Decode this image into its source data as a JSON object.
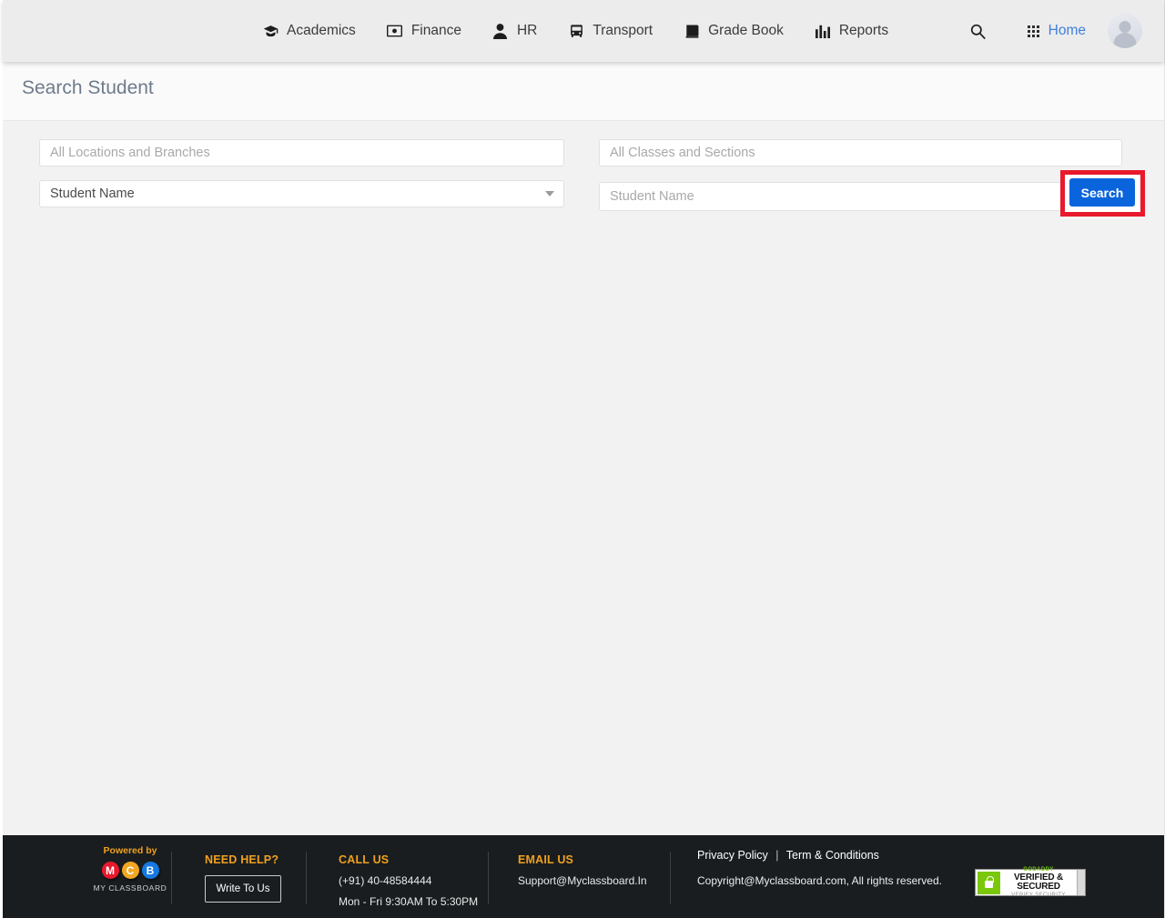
{
  "nav": {
    "items": [
      {
        "label": "Academics",
        "icon": "graduation-cap-icon"
      },
      {
        "label": "Finance",
        "icon": "banknote-icon"
      },
      {
        "label": "HR",
        "icon": "person-icon"
      },
      {
        "label": "Transport",
        "icon": "bus-icon"
      },
      {
        "label": "Grade Book",
        "icon": "book-icon"
      },
      {
        "label": "Reports",
        "icon": "bar-chart-icon"
      }
    ],
    "search_icon": "search-icon",
    "apps_icon": "apps-grid-icon",
    "home_label": "Home",
    "home_color": "#3f7fdb",
    "avatar_icon": "user-avatar-icon"
  },
  "header": {
    "title": "Search Student"
  },
  "form": {
    "locations_placeholder": "All Locations and Branches",
    "locations_value": "",
    "classes_placeholder": "All Classes and Sections",
    "classes_value": "",
    "search_by_value": "Student Name",
    "search_by_caret": "chevron-down-icon",
    "student_name_placeholder": "Student Name",
    "student_name_value": "",
    "search_button_label": "Search",
    "search_button_color": "#0a65dd",
    "highlight_color": "#e8192c"
  },
  "footer": {
    "powered_by_label": "Powered by",
    "brand_letters": [
      "M",
      "C",
      "B"
    ],
    "brand_name": "MY CLASSBOARD",
    "brand_colors": [
      "#e8192c",
      "#f2a621",
      "#1579e0"
    ],
    "need_help_heading": "NEED HELP?",
    "write_to_us_label": "Write To Us",
    "call_us_heading": "CALL US",
    "phone": "(+91) 40-48584444",
    "hours": "Mon - Fri    9:30AM To 5:30PM",
    "email_us_heading": "EMAIL US",
    "email": "Support@Myclassboard.In",
    "privacy_policy": "Privacy Policy",
    "separator": "|",
    "terms": "Term & Conditions",
    "copyright": "Copyright@Myclassboard.com, All rights reserved.",
    "seal": {
      "brand": "GODADDY",
      "line2": "VERIFIED & SECURED",
      "line3": "VERIFY SECURITY",
      "icon": "lock-icon"
    },
    "accent_color": "#f0a01e",
    "background": "#191d20"
  }
}
